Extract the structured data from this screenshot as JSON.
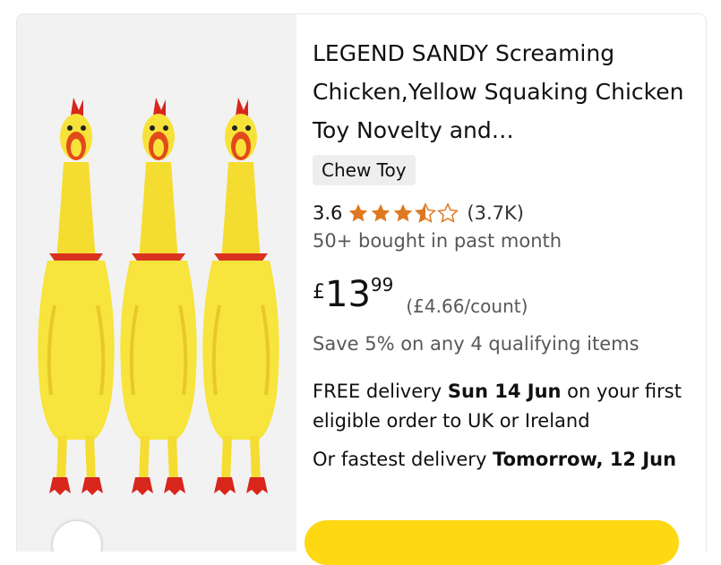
{
  "product": {
    "title": "LEGEND SANDY Screaming Chicken,Yellow Squaking Chicken Toy Novelty and…",
    "badge": "Chew Toy",
    "rating": {
      "value": "3.6",
      "stars": 3.5,
      "count": "(3.7K)",
      "star_color": "#de7921"
    },
    "bought": "50+ bought in past month",
    "price": {
      "currency": "£",
      "whole": "13",
      "fraction": "99",
      "unit_price": "(£4.66/count)"
    },
    "promo": "Save 5% on any 4 qualifying items",
    "delivery": {
      "prefix": "FREE delivery ",
      "date": "Sun 14 Jun",
      "suffix": " on your first eligible order to UK or Ireland"
    },
    "fastest": {
      "prefix": "Or fastest delivery ",
      "date": "Tomorrow, 12 Jun"
    },
    "add_to_basket_color": "#ffd814"
  },
  "image": {
    "subject": "three yellow rubber screaming chickens",
    "background": "#f2f2f2"
  }
}
